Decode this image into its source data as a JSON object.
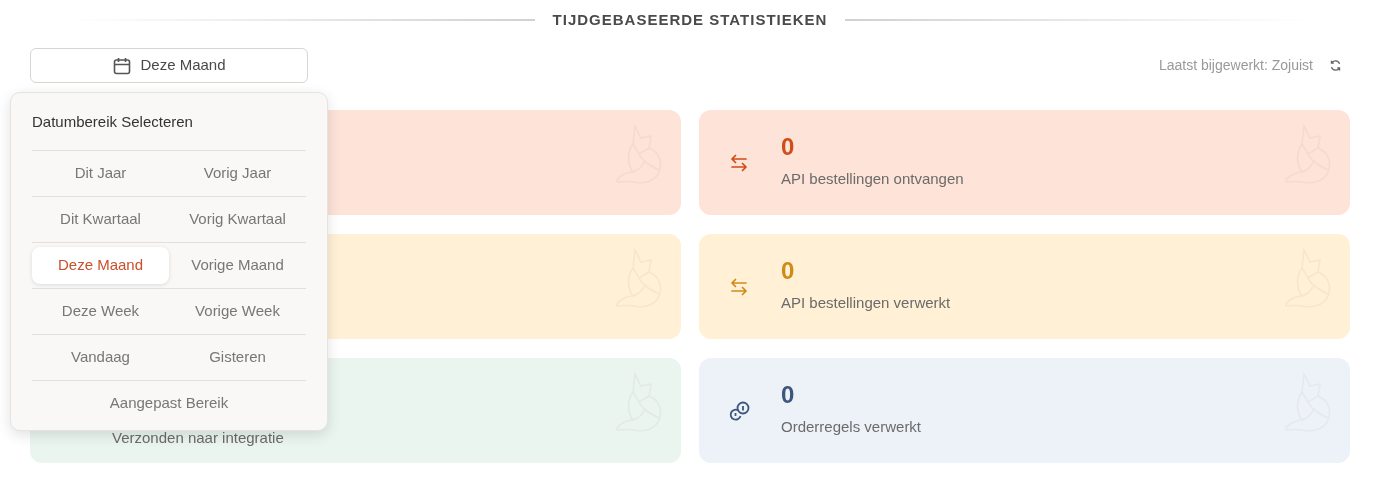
{
  "header": {
    "title": "TIJDGEBASEERDE STATISTIEKEN"
  },
  "date_button": {
    "label": "Deze Maand"
  },
  "last_updated": {
    "text": "Laatst bijgewerkt: Zojuist"
  },
  "date_menu": {
    "title": "Datumbereik Selecteren",
    "rows": [
      {
        "options": [
          {
            "label": "Dit Jaar",
            "selected": false
          },
          {
            "label": "Vorig Jaar",
            "selected": false
          }
        ]
      },
      {
        "options": [
          {
            "label": "Dit Kwartaal",
            "selected": false
          },
          {
            "label": "Vorig Kwartaal",
            "selected": false
          }
        ]
      },
      {
        "options": [
          {
            "label": "Deze Maand",
            "selected": true
          },
          {
            "label": "Vorige Maand",
            "selected": false
          }
        ]
      },
      {
        "options": [
          {
            "label": "Deze Week",
            "selected": false
          },
          {
            "label": "Vorige Week",
            "selected": false
          }
        ]
      },
      {
        "options": [
          {
            "label": "Vandaag",
            "selected": false
          },
          {
            "label": "Gisteren",
            "selected": false
          }
        ]
      },
      {
        "options": [
          {
            "label": "Aangepast Bereik",
            "selected": false
          }
        ]
      }
    ]
  },
  "cards": [
    {
      "color": "#fde3d8"
    },
    {
      "color": "#fde3d8",
      "kind": "transfer",
      "value": "0",
      "label": "API bestellingen ontvangen"
    },
    {
      "color": "#fff0d6"
    },
    {
      "color": "#fff0d6",
      "kind": "transfer",
      "value": "0",
      "label": "API bestellingen verwerkt"
    },
    {
      "color": "#e9f5ee",
      "label": "Verzonden naar integratie"
    },
    {
      "color": "#edf2f9",
      "kind": "coins",
      "value": "0",
      "label": "Orderregels verwerkt"
    }
  ]
}
